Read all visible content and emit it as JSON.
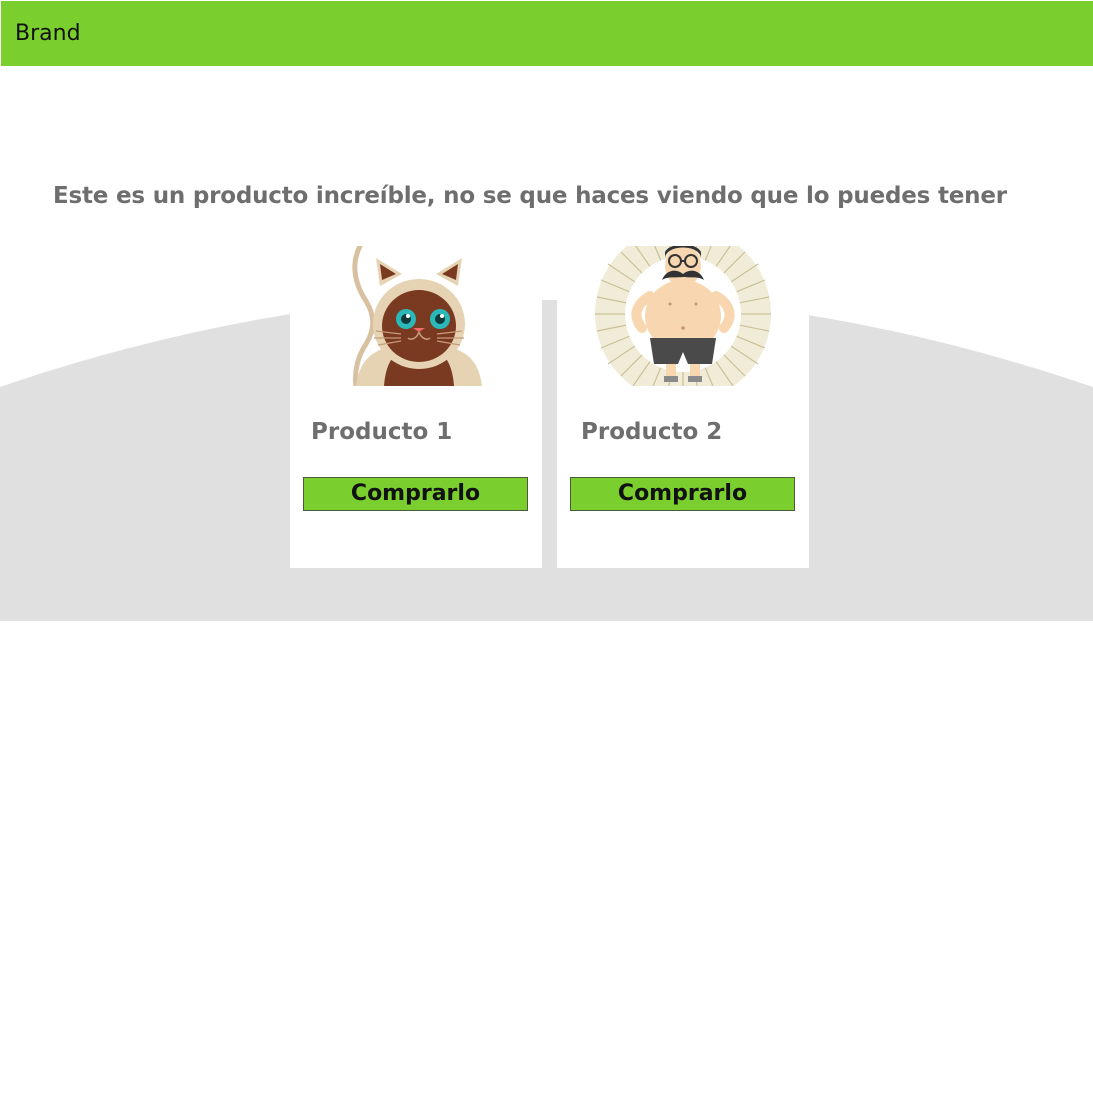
{
  "navbar": {
    "brand": "Brand",
    "color": "#7ace2d"
  },
  "hero": {
    "tagline": "Este es un producto increíble, no se que haces viendo que lo puedes tener",
    "band_color": "#e1e0e1"
  },
  "products": [
    {
      "title": "Producto 1",
      "image": "cat-illustration",
      "button_label": "Comprarlo"
    },
    {
      "title": "Producto 2",
      "image": "mustache-man-illustration",
      "button_label": "Comprarlo"
    }
  ]
}
